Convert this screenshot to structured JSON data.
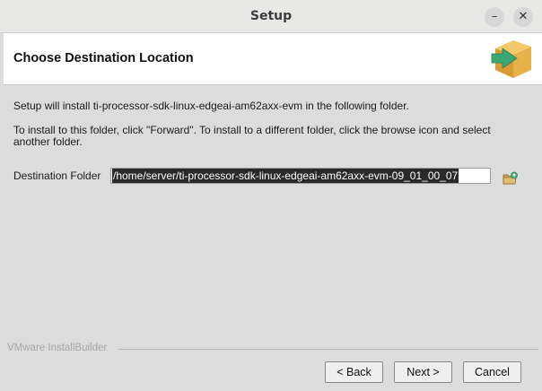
{
  "window": {
    "title": "Setup",
    "minimize_glyph": "–",
    "close_glyph": "✕"
  },
  "header": {
    "title": "Choose Destination Location",
    "logo_icon": "installer-box-arrow-icon"
  },
  "content": {
    "line1": "Setup will install ti-processor-sdk-linux-edgeai-am62axx-evm in the following folder.",
    "line2": "To install to this folder, click \"Forward\". To install to a different folder, click the browse icon and select another folder.",
    "destination_label": "Destination Folder",
    "destination_value": "/home/server/ti-processor-sdk-linux-edgeai-am62axx-evm-09_01_00_07",
    "browse_icon": "folder-browse-icon"
  },
  "footer": {
    "brand": "VMware InstallBuilder"
  },
  "buttons": {
    "back": "< Back",
    "next": "Next >",
    "cancel": "Cancel"
  },
  "colors": {
    "background": "#dcdcdc",
    "header_bg": "#ffffff",
    "selection_bg": "#2a2a2a",
    "logo_box": "#e8b24a",
    "logo_arrow": "#3aa874"
  }
}
